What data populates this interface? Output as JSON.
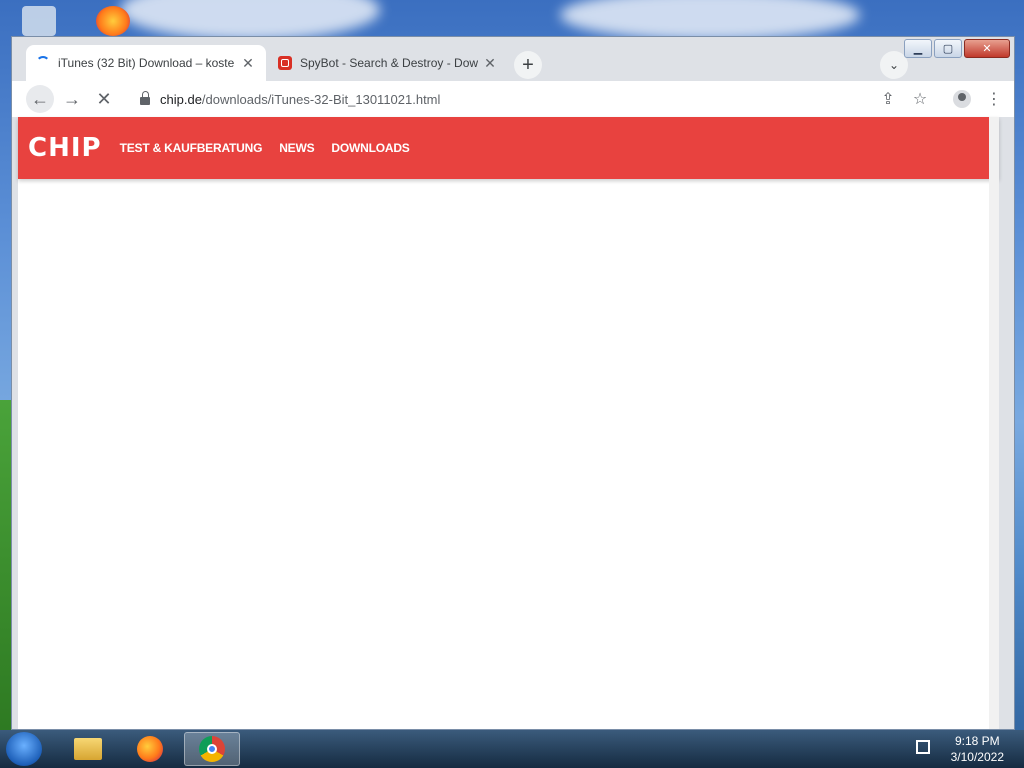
{
  "tabs": [
    {
      "title": "iTunes (32 Bit) Download – koste",
      "close": "✕",
      "favicon": "loading-spinner-icon"
    },
    {
      "title": "SpyBot - Search & Destroy - Dow",
      "close": "✕",
      "favicon": "spybot-icon"
    }
  ],
  "tabstrip": {
    "new_tab": "+",
    "tab_search": "⌄"
  },
  "window_controls": {
    "minimize": "▁",
    "maximize": "▢",
    "close": "✕"
  },
  "toolbar": {
    "back": "←",
    "forward": "→",
    "stop": "✕",
    "url_host": "chip.de",
    "url_path": "/downloads/iTunes-32-Bit_13011021.html",
    "share": "⇪",
    "bookmark": "☆",
    "menu": "⋮"
  },
  "page": {
    "logo": "CHIP",
    "nav": [
      "TEST & KAUFBERATUNG",
      "NEWS",
      "DOWNLOADS"
    ],
    "brand_color": "#e8423f"
  },
  "taskbar": {
    "time": "9:18 PM",
    "date": "3/10/2022",
    "apps": [
      "file-explorer-icon",
      "firefox-icon",
      "chrome-icon"
    ]
  }
}
